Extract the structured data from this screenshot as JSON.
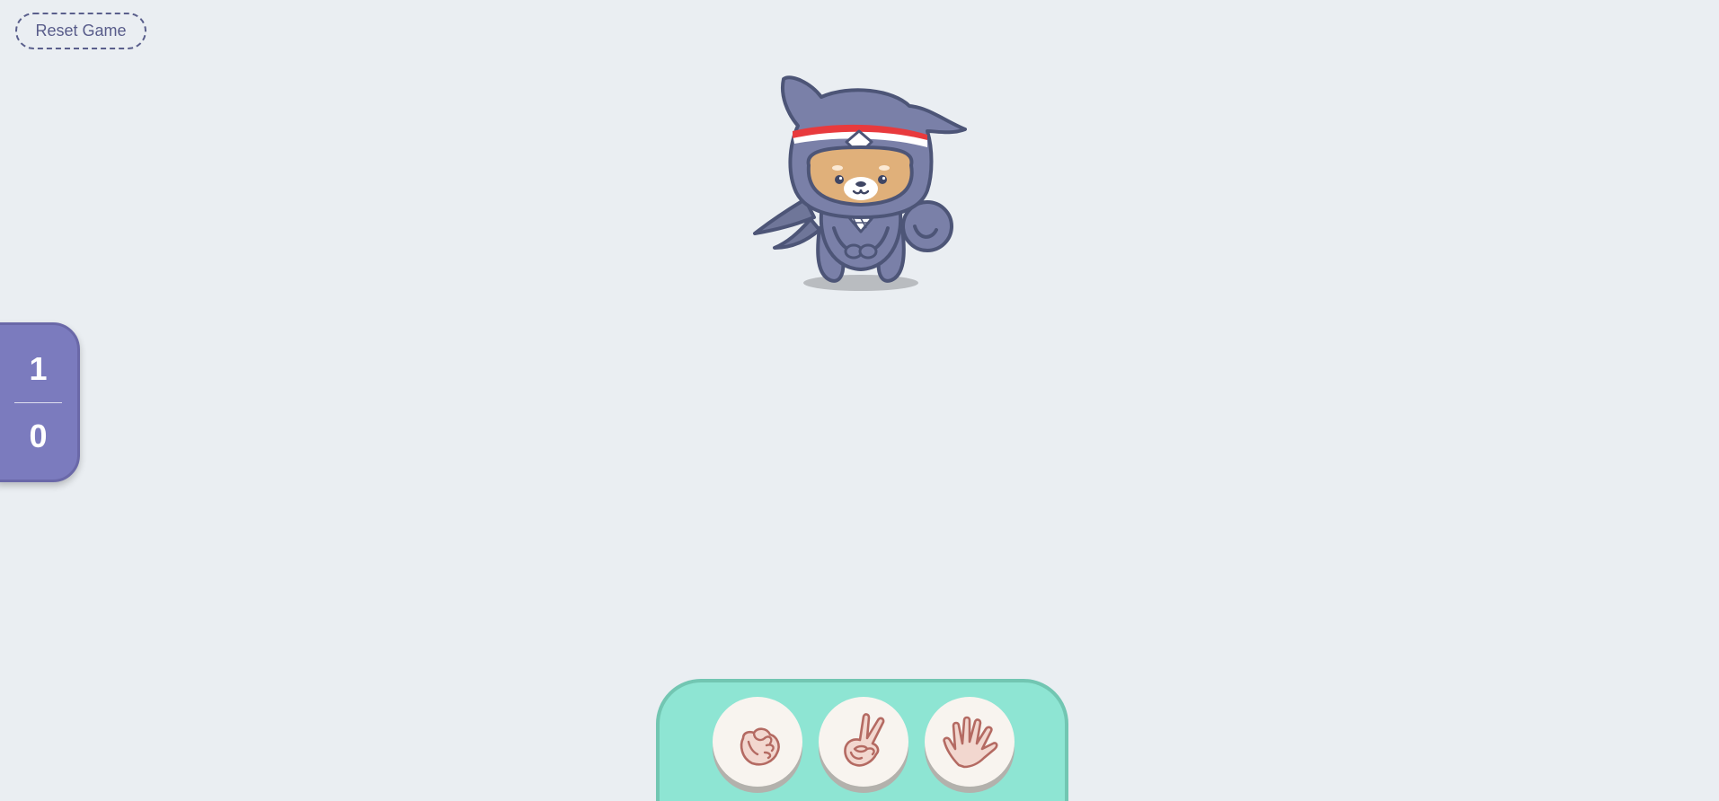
{
  "controls": {
    "reset_label": "Reset Game"
  },
  "scoreboard": {
    "top_score": "1",
    "bottom_score": "0"
  },
  "opponent": {
    "icon": "ninja-shiba-mascot"
  },
  "choices": [
    {
      "icon": "rock-fist-icon"
    },
    {
      "icon": "scissors-peace-icon"
    },
    {
      "icon": "paper-open-hand-icon"
    }
  ],
  "colors": {
    "background": "#eaeef2",
    "score_panel": "#7b7bbe",
    "tray": "#8ee5d3",
    "tray_border": "#72c6b2",
    "choice_button": "#f8f4ef",
    "hand_fill": "#f2d7cf",
    "hand_stroke": "#b46a62",
    "ninja_body": "#7a80a8",
    "headband": "#e83a3d"
  }
}
